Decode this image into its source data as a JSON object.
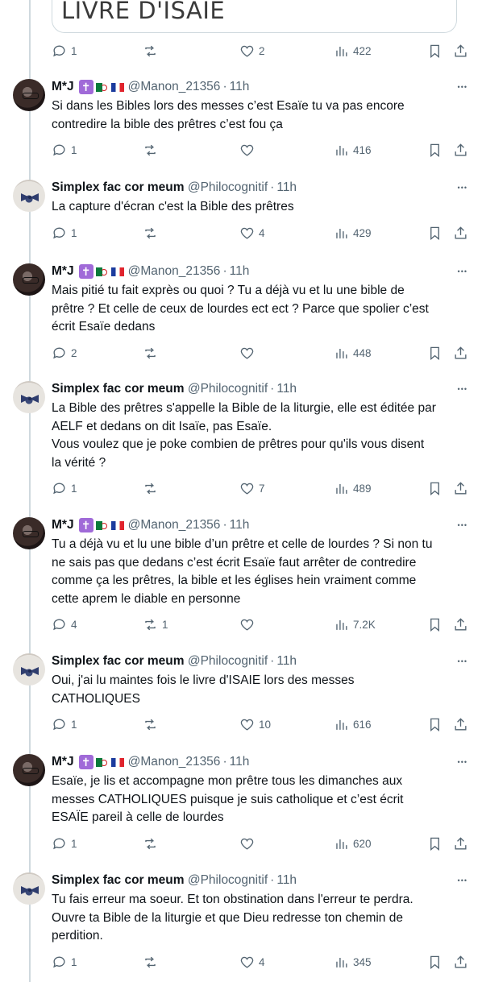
{
  "embed": {
    "text": "LIVRE D'ISAÏE"
  },
  "first_actions": {
    "replies": "1",
    "reposts": "",
    "likes": "2",
    "views": "422"
  },
  "tweets": [
    {
      "name": "M*J",
      "badges": true,
      "handle": "@Manon_21356",
      "time": "11h",
      "avatar": "dark",
      "lines": [
        "Si dans les Bibles lors des messes c’est Esaïe tu va pas encore",
        "contredire la bible des prêtres c’est fou ça"
      ],
      "replies": "1",
      "reposts": "",
      "likes": "",
      "views": "416"
    },
    {
      "name": "Simplex fac cor meum",
      "badges": false,
      "handle": "@Philocognitif",
      "time": "11h",
      "avatar": "light",
      "lines": [
        "La capture d'écran c'est la Bible des prêtres"
      ],
      "replies": "1",
      "reposts": "",
      "likes": "4",
      "views": "429"
    },
    {
      "name": "M*J",
      "badges": true,
      "handle": "@Manon_21356",
      "time": "11h",
      "avatar": "dark",
      "lines": [
        "Mais pitié tu fait exprès ou quoi ? Tu a déjà vu et lu une bible de",
        "prêtre ? Et celle de ceux de lourdes ect ect ? Parce que spolier c’est",
        "écrit Esaïe dedans"
      ],
      "replies": "2",
      "reposts": "",
      "likes": "",
      "views": "448"
    },
    {
      "name": "Simplex fac cor meum",
      "badges": false,
      "handle": "@Philocognitif",
      "time": "11h",
      "avatar": "light",
      "lines": [
        "La Bible des prêtres s'appelle la Bible de la liturgie, elle est éditée par",
        "AELF et dedans on dit Isaïe, pas Esaïe.",
        "Vous voulez que je poke combien de prêtres pour qu'ils vous disent",
        "la vérité ?"
      ],
      "replies": "1",
      "reposts": "",
      "likes": "7",
      "views": "489"
    },
    {
      "name": "M*J",
      "badges": true,
      "handle": "@Manon_21356",
      "time": "11h",
      "avatar": "dark",
      "lines": [
        "Tu a déjà vu et lu une bible d’un prêtre et celle de lourdes ? Si non tu",
        "ne sais pas que dedans c’est écrit Esaïe faut arrêter de contredire",
        "comme ça les prêtres, la bible et les églises hein vraiment comme",
        "cette aprem le diable en personne"
      ],
      "replies": "4",
      "reposts": "1",
      "likes": "",
      "views": "7.2K"
    },
    {
      "name": "Simplex fac cor meum",
      "badges": false,
      "handle": "@Philocognitif",
      "time": "11h",
      "avatar": "light",
      "lines": [
        "Oui, j'ai lu maintes fois le livre d'ISAIE lors des messes",
        "CATHOLIQUES"
      ],
      "replies": "1",
      "reposts": "",
      "likes": "10",
      "views": "616"
    },
    {
      "name": "M*J",
      "badges": true,
      "handle": "@Manon_21356",
      "time": "11h",
      "avatar": "dark",
      "lines": [
        "Esaïe, je lis et accompagne mon prêtre tous les dimanches aux",
        "messes CATHOLIQUES puisque je suis catholique et c’est écrit",
        "ESAÏE pareil à celle de lourdes"
      ],
      "replies": "1",
      "reposts": "",
      "likes": "",
      "views": "620"
    },
    {
      "name": "Simplex fac cor meum",
      "badges": false,
      "handle": "@Philocognitif",
      "time": "11h",
      "avatar": "light",
      "lines": [
        "Tu fais erreur ma soeur. Et ton obstination dans l'erreur te perdra.",
        "Ouvre ta Bible de la liturgie et que Dieu redresse ton chemin de",
        "perdition."
      ],
      "replies": "1",
      "reposts": "",
      "likes": "4",
      "views": "345"
    }
  ],
  "colors": {
    "text": "#0f1419",
    "muted": "#536471",
    "thread_line": "#cfd9de",
    "badge_purple": "#a06ad8"
  },
  "icons": [
    "reply-icon",
    "repost-icon",
    "like-icon",
    "views-icon",
    "bookmark-icon",
    "share-icon",
    "more-icon"
  ]
}
